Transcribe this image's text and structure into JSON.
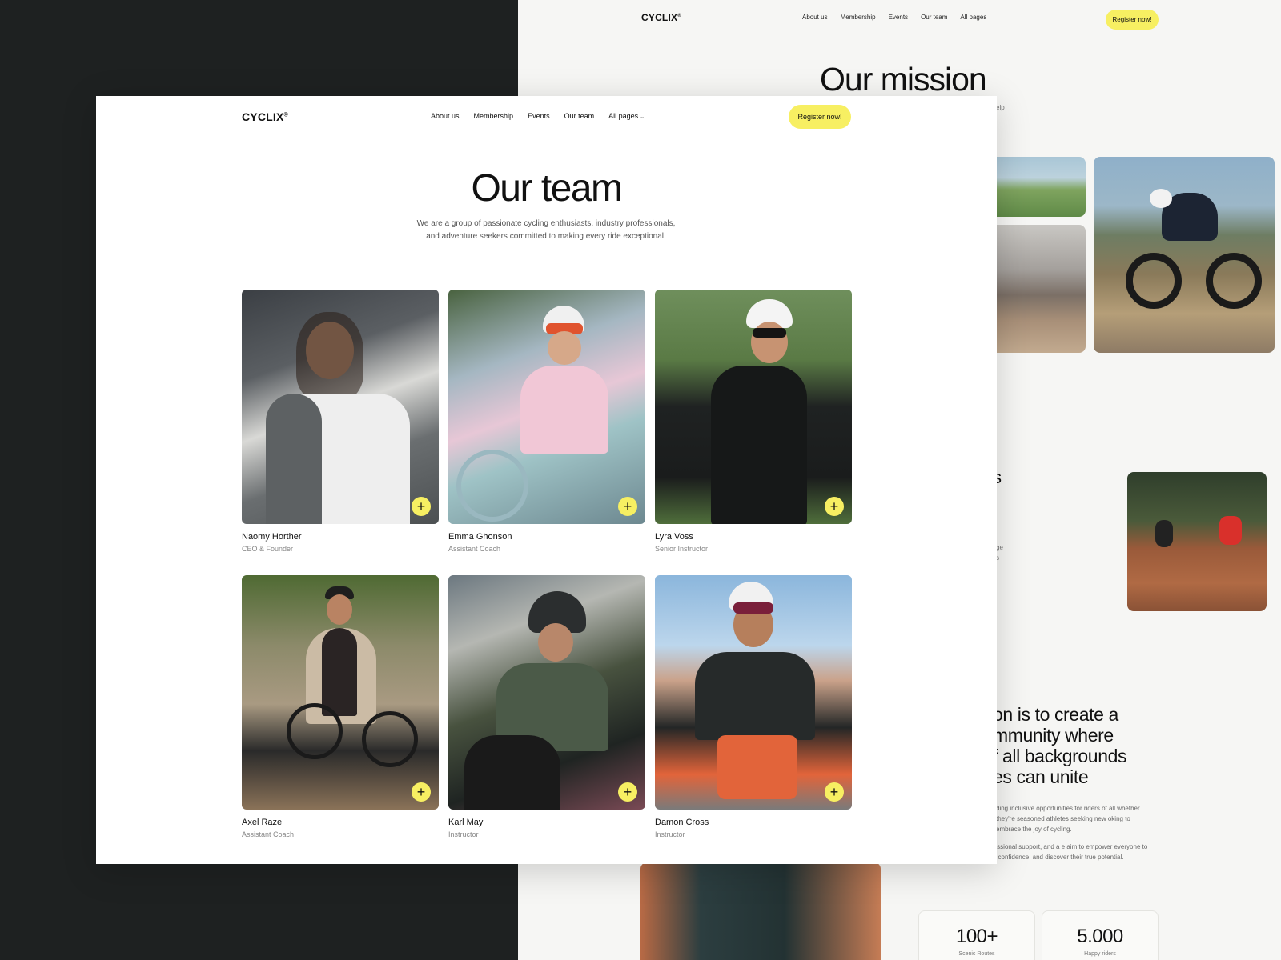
{
  "back_page": {
    "logo": "CYCLIX",
    "logo_mark": "®",
    "menu": [
      "About us",
      "Membership",
      "Events",
      "Our team",
      "All pages"
    ],
    "register": "Register now!",
    "mission_title": "Our mission",
    "title_fragment": "elp",
    "section_fragment": "s",
    "small_fragment_1": "ge",
    "small_fragment_2": "s",
    "quote_lines": [
      "on is to create a",
      "mmunity where",
      "f all backgrounds",
      "es can unite"
    ],
    "para_1": "ding inclusive opportunities for riders of all whether they're seasoned athletes seeking new oking to embrace the joy of cycling.",
    "para_2": "utes, expert guidance, professional support, and a e aim to empower everyone to push their boundaries, build confidence, and discover their true potential.",
    "stats": [
      {
        "value": "100+",
        "label": "Scenic Routes"
      },
      {
        "value": "5.000",
        "label": "Happy riders"
      }
    ]
  },
  "front_page": {
    "logo": "CYCLIX",
    "logo_mark": "®",
    "menu": [
      "About us",
      "Membership",
      "Events",
      "Our team",
      "All pages"
    ],
    "menu_chevron": "⌄",
    "register": "Register now!",
    "title": "Our team",
    "description_line_1": "We are a group of passionate cycling enthusiasts, industry professionals,",
    "description_line_2": "and adventure seekers committed to making every ride exceptional.",
    "plus_symbol": "+",
    "members": [
      {
        "name": "Naomy Horther",
        "role": "CEO & Founder"
      },
      {
        "name": "Emma Ghonson",
        "role": "Assistant Coach"
      },
      {
        "name": "Lyra Voss",
        "role": "Senior Instructor"
      },
      {
        "name": "Axel Raze",
        "role": "Assistant Coach"
      },
      {
        "name": "Karl May",
        "role": "Instructor"
      },
      {
        "name": "Damon Cross",
        "role": "Instructor"
      }
    ]
  },
  "colors": {
    "accent": "#f7ef62",
    "dark_bg": "#1e2121",
    "light_bg": "#f6f6f4"
  }
}
